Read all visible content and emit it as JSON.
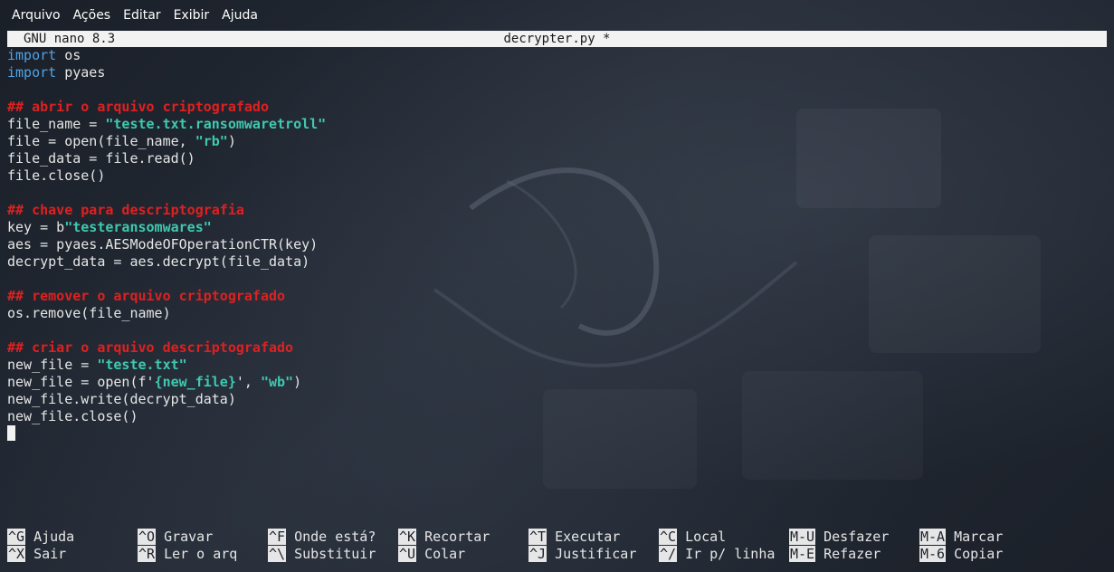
{
  "menubar": [
    "Arquivo",
    "Ações",
    "Editar",
    "Exibir",
    "Ajuda"
  ],
  "nano": {
    "version": "GNU nano 8.3",
    "filename": "decrypter.py *"
  },
  "code": [
    [
      {
        "t": "import",
        "c": "kw"
      },
      {
        "t": " os"
      }
    ],
    [
      {
        "t": "import",
        "c": "kw"
      },
      {
        "t": " pyaes"
      }
    ],
    [],
    [
      {
        "t": "## abrir o arquivo criptografado",
        "c": "cm"
      }
    ],
    [
      {
        "t": "file_name = "
      },
      {
        "t": "\"teste.txt.ransomwaretroll\"",
        "c": "st"
      }
    ],
    [
      {
        "t": "file = open(file_name, "
      },
      {
        "t": "\"rb\"",
        "c": "st"
      },
      {
        "t": ")"
      }
    ],
    [
      {
        "t": "file_data = file.read()"
      }
    ],
    [
      {
        "t": "file.close()"
      }
    ],
    [],
    [
      {
        "t": "## chave para descriptografia",
        "c": "cm"
      }
    ],
    [
      {
        "t": "key = b"
      },
      {
        "t": "\"testeransomwares\"",
        "c": "st"
      }
    ],
    [
      {
        "t": "aes = pyaes.AESModeOFOperationCTR(key)"
      }
    ],
    [
      {
        "t": "decrypt_data = aes.decrypt(file_data)"
      }
    ],
    [],
    [
      {
        "t": "## remover o arquivo criptografado",
        "c": "cm"
      }
    ],
    [
      {
        "t": "os.remove(file_name)"
      }
    ],
    [],
    [
      {
        "t": "## criar o arquivo descriptografado",
        "c": "cm"
      }
    ],
    [
      {
        "t": "new_file = "
      },
      {
        "t": "\"teste.txt\"",
        "c": "st"
      }
    ],
    [
      {
        "t": "new_file = open(f'"
      },
      {
        "t": "{new_file}",
        "c": "st"
      },
      {
        "t": "', "
      },
      {
        "t": "\"wb\"",
        "c": "st"
      },
      {
        "t": ")"
      }
    ],
    [
      {
        "t": "new_file.write(decrypt_data)"
      }
    ],
    [
      {
        "t": "new_file.close()"
      }
    ]
  ],
  "shortcuts": [
    [
      {
        "key": "^G",
        "label": "Ajuda"
      },
      {
        "key": "^O",
        "label": "Gravar"
      },
      {
        "key": "^F",
        "label": "Onde está?"
      },
      {
        "key": "^K",
        "label": "Recortar"
      },
      {
        "key": "^T",
        "label": "Executar"
      },
      {
        "key": "^C",
        "label": "Local"
      },
      {
        "key": "M-U",
        "label": "Desfazer"
      },
      {
        "key": "M-A",
        "label": "Marcar"
      }
    ],
    [
      {
        "key": "^X",
        "label": "Sair"
      },
      {
        "key": "^R",
        "label": "Ler o arq"
      },
      {
        "key": "^\\",
        "label": "Substituir"
      },
      {
        "key": "^U",
        "label": "Colar"
      },
      {
        "key": "^J",
        "label": "Justificar"
      },
      {
        "key": "^/",
        "label": "Ir p/ linha"
      },
      {
        "key": "M-E",
        "label": "Refazer"
      },
      {
        "key": "M-6",
        "label": "Copiar"
      }
    ]
  ]
}
